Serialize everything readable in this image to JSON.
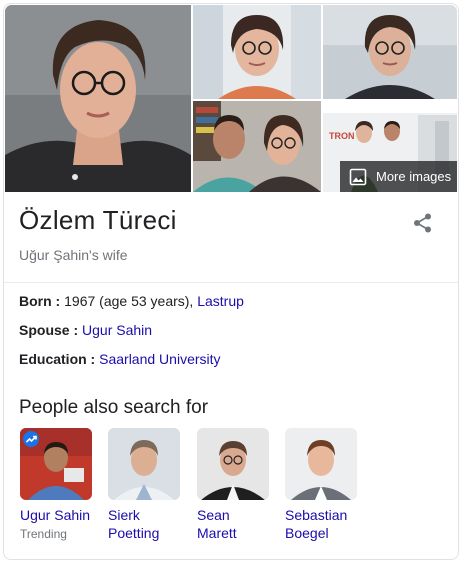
{
  "panel": {
    "more_images_label": "More images",
    "title": "Özlem Türeci",
    "subtitle": "Uğur Şahin's wife",
    "facts": {
      "born": {
        "label": "Born",
        "text": " 1967 (age 53 years), ",
        "link": "Lastrup"
      },
      "spouse": {
        "label": "Spouse",
        "link": "Ugur Sahin"
      },
      "education": {
        "label": "Education",
        "link": "Saarland University"
      }
    },
    "people_also_search_title": "People also search for",
    "people": [
      {
        "name_line1": "Ugur Sahin",
        "name_line2": "",
        "sub": "Trending"
      },
      {
        "name_line1": "Sierk",
        "name_line2": "Poetting",
        "sub": ""
      },
      {
        "name_line1": "Sean",
        "name_line2": "Marett",
        "sub": ""
      },
      {
        "name_line1": "Sebastian",
        "name_line2": "Boegel",
        "sub": ""
      }
    ],
    "tron_text": "TRON"
  },
  "colors": {
    "link": "#1a0dab",
    "text": "#202124",
    "muted": "#70757a",
    "border": "#dfe1e5",
    "trend": "#1a73e8"
  }
}
